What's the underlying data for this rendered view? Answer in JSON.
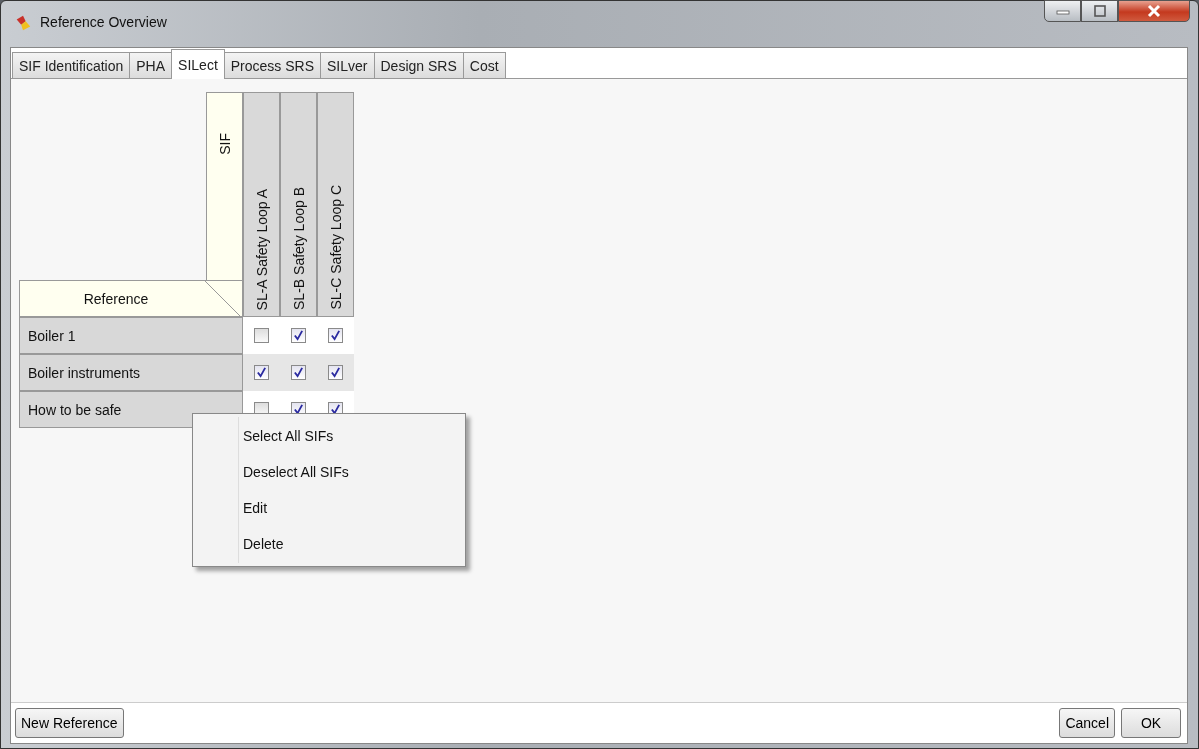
{
  "window": {
    "title": "Reference Overview"
  },
  "tabs": [
    {
      "label": "SIF Identification",
      "selected": false
    },
    {
      "label": "PHA",
      "selected": false
    },
    {
      "label": "SILect",
      "selected": true
    },
    {
      "label": "Process SRS",
      "selected": false
    },
    {
      "label": "SILver",
      "selected": false
    },
    {
      "label": "Design SRS",
      "selected": false
    },
    {
      "label": "Cost",
      "selected": false
    }
  ],
  "matrix": {
    "row_header": "Reference",
    "column_header": "SIF",
    "columns": [
      "SL-A Safety Loop A",
      "SL-B Safety Loop B",
      "SL-C Safety Loop C"
    ],
    "rows": [
      {
        "label": "Boiler 1",
        "checks": [
          false,
          true,
          true
        ]
      },
      {
        "label": "Boiler instruments",
        "checks": [
          true,
          true,
          true
        ]
      },
      {
        "label": "How to be safe",
        "checks": [
          false,
          true,
          true
        ]
      }
    ]
  },
  "context_menu": {
    "items": [
      "Select All SIFs",
      "Deselect All SIFs",
      "Edit",
      "Delete"
    ]
  },
  "buttons": {
    "left": "New Reference",
    "cancel": "Cancel",
    "ok": "OK"
  }
}
